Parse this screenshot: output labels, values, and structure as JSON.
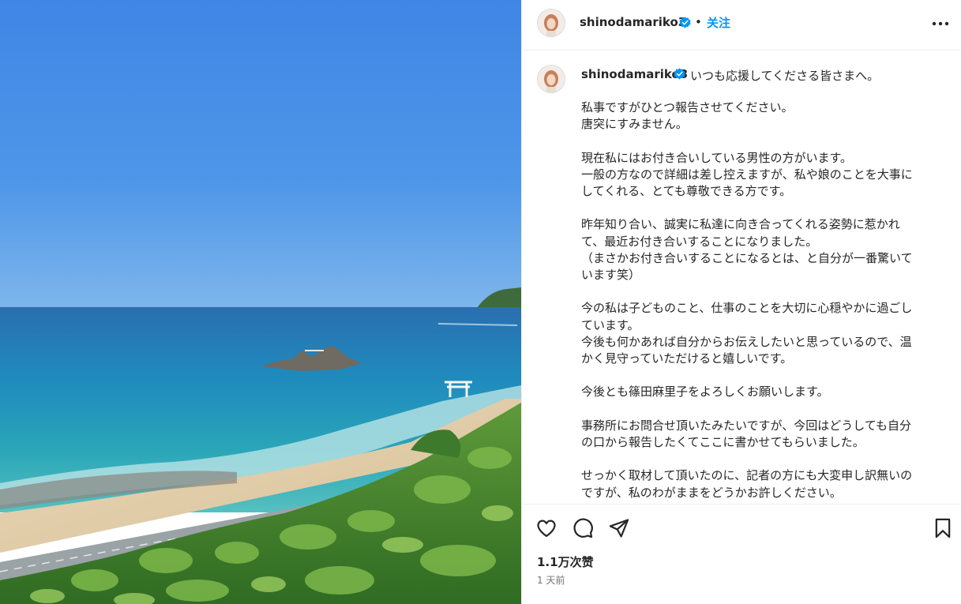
{
  "post": {
    "username": "shinodamariko3",
    "follow_label": "关注",
    "separator": "•",
    "caption_first_line": "いつも応援してくださる皆さまへ。",
    "caption_paragraphs": [
      [
        "私事ですがひとつ報告させてください。",
        "唐突にすみません。"
      ],
      [
        "現在私にはお付き合いしている男性の方がいます。",
        "一般の方なので詳細は差し控えますが、私や娘のことを大事に",
        "してくれる、とても尊敬できる方です。"
      ],
      [
        "昨年知り合い、誠実に私達に向き合ってくれる姿勢に惹かれ",
        "て、最近お付き合いすることになりました。",
        "（まさかお付き合いすることになるとは、と自分が一番驚いて",
        "います笑）"
      ],
      [
        "今の私は子どものこと、仕事のことを大切に心穏やかに過ごし",
        "ています。",
        "今後も何かあれば自分からお伝えしたいと思っているので、温",
        "かく見守っていただけると嬉しいです。"
      ],
      [
        "今後とも篠田麻里子をよろしくお願いします。"
      ],
      [
        "事務所にお問合せ頂いたみたいですが、今回はどうしても自分",
        "の口から報告したくてここに書かせてもらいました。"
      ],
      [
        "せっかく取材して頂いたのに、記者の方にも大変申し訳無いの",
        "ですが、私のわがままをどうかお許しください。"
      ]
    ],
    "likes": "1.1万次赞",
    "time_ago": "1 天前",
    "icons": {
      "more": "more-horizontal-icon",
      "like": "heart-icon",
      "comment": "comment-icon",
      "share": "share-icon",
      "save": "bookmark-icon",
      "verified": "verified-badge-icon"
    },
    "colors": {
      "accent": "#0095f6",
      "verified": "#0095f6",
      "text": "#262626",
      "secondary": "#737373",
      "border": "#efefef"
    }
  }
}
